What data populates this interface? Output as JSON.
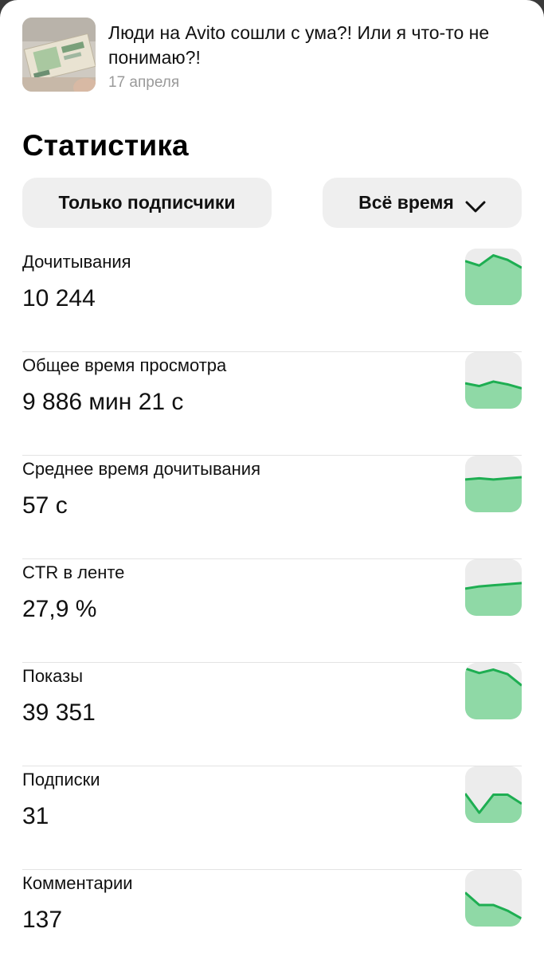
{
  "article": {
    "title": "Люди на Avito сошли с ума?! Или я что-то не понимаю?!",
    "date": "17 апреля"
  },
  "stats": {
    "title": "Статистика",
    "filter_subscribers": "Только подписчики",
    "period": "Всё время"
  },
  "metrics": [
    {
      "label": "Дочитывания",
      "value": "10 244",
      "trend": [
        0.22,
        0.3,
        0.12,
        0.2,
        0.34
      ]
    },
    {
      "label": "Общее время просмотра",
      "value": "9 886 мин 21 с",
      "trend": [
        0.55,
        0.6,
        0.52,
        0.57,
        0.64
      ]
    },
    {
      "label": "Среднее время дочитывания",
      "value": "57 с",
      "trend": [
        0.42,
        0.4,
        0.42,
        0.4,
        0.38
      ]
    },
    {
      "label": "CTR в ленте",
      "value": "27,9 %",
      "trend": [
        0.52,
        0.48,
        0.46,
        0.44,
        0.42
      ]
    },
    {
      "label": "Показы",
      "value": "39 351",
      "trend": [
        0.1,
        0.18,
        0.12,
        0.2,
        0.4
      ]
    },
    {
      "label": "Подписки",
      "value": "31",
      "trend": [
        0.48,
        0.82,
        0.5,
        0.5,
        0.66
      ]
    },
    {
      "label": "Комментарии",
      "value": "137",
      "trend": [
        0.4,
        0.62,
        0.62,
        0.72,
        0.86
      ]
    }
  ],
  "colors": {
    "accent": "#1eae52",
    "fill": "#8fd9a6",
    "pill_bg": "#efefef"
  },
  "icons": {
    "period_chevron": "chevron-down-icon"
  }
}
